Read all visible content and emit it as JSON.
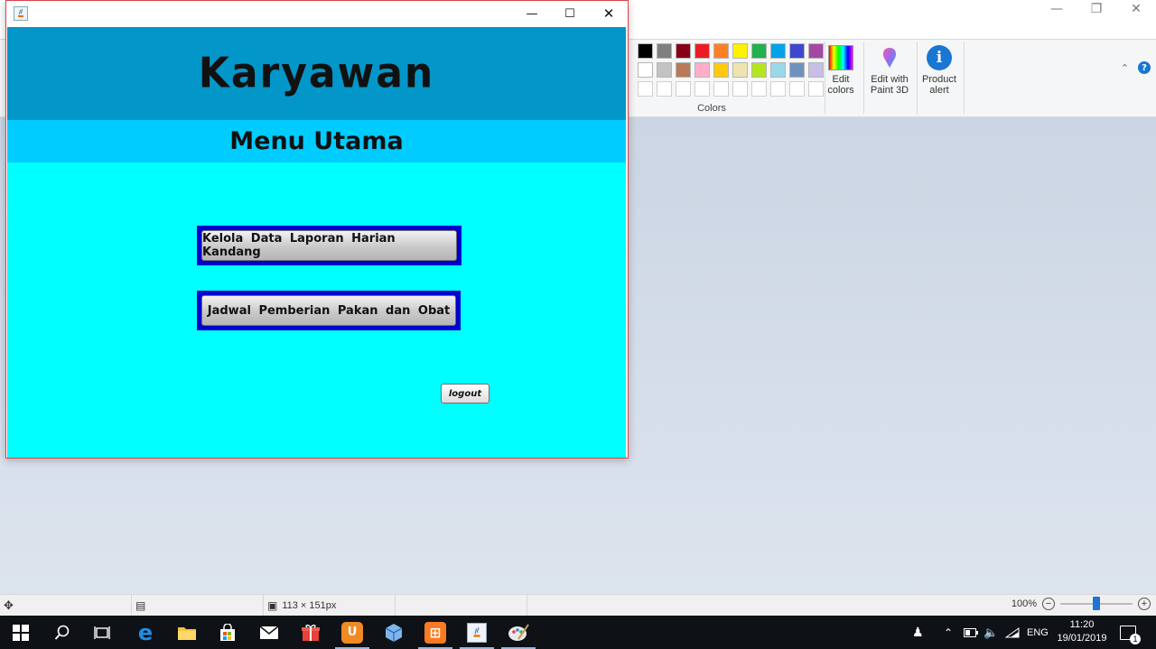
{
  "app": {
    "header_title": "Karyawan",
    "sub_title": "Menu Utama",
    "buttons": {
      "laporan": "Kelola Data Laporan Harian Kandang",
      "jadwal": "Jadwal Pemberian Pakan dan Obat",
      "logout": "logout"
    },
    "window_controls": [
      "minimize",
      "maximize",
      "close"
    ]
  },
  "paint": {
    "palette_row1": [
      "#000000",
      "#7f7f7f",
      "#880015",
      "#ed1c24",
      "#ff7f27",
      "#fff200",
      "#22b14c",
      "#00a2e8",
      "#3f48cc",
      "#a349a4"
    ],
    "palette_row2": [
      "#ffffff",
      "#c3c3c3",
      "#b97a57",
      "#ffaec9",
      "#ffc90e",
      "#efe4b0",
      "#b5e61d",
      "#99d9ea",
      "#7092be",
      "#c8bfe7"
    ],
    "colors_label": "Colors",
    "edit_colors": "Edit colors",
    "edit_paint3d": "Edit with Paint 3D",
    "product_alert": "Product alert",
    "status_size": "113 × 151px",
    "zoom": "100%",
    "zoom_slider_fraction": 0.5
  },
  "taskbar": {
    "language": "ENG",
    "time": "11:20",
    "date": "19/01/2019",
    "notification_count": "1"
  }
}
